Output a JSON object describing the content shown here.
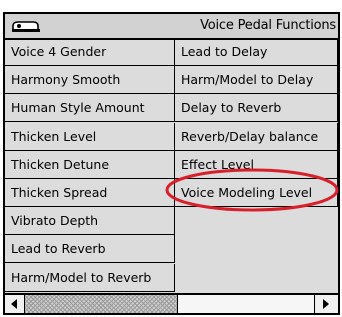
{
  "title": "Voice Pedal Functions",
  "title_icon": "pedal-icon",
  "left_column": [
    "Voice 4 Gender",
    "Harmony Smooth",
    "Human Style Amount",
    "Thicken Level",
    "Thicken Detune",
    "Thicken Spread",
    "Vibrato Depth",
    "Lead to Reverb",
    "Harm/Model to Reverb"
  ],
  "right_column": [
    "Lead to Delay",
    "Harm/Model to Delay",
    "Delay to Reverb",
    "Reverb/Delay balance",
    "Effect Level",
    "Voice Modeling Level"
  ],
  "highlighted_item": "Voice Modeling Level",
  "colors": {
    "highlight_ring": "#d8202a",
    "panel_bg": "#dcdcdc",
    "grid_lines": "#000000"
  }
}
